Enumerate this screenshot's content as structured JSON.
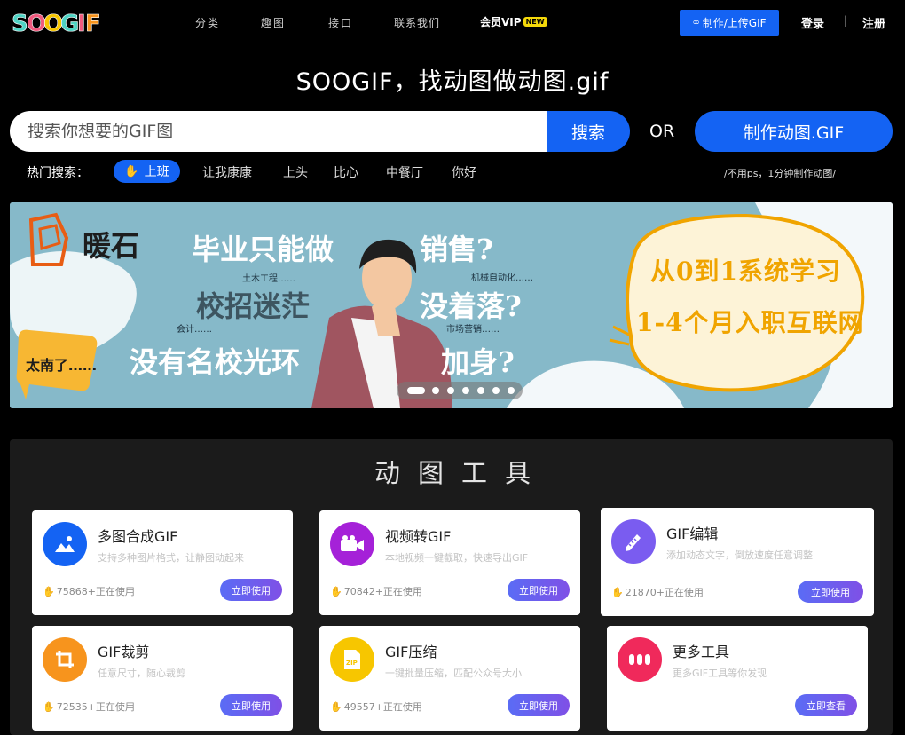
{
  "nav": {
    "logo_text": "SOOGIF",
    "links": [
      "分类",
      "趣图",
      "接口",
      "联系我们"
    ],
    "vip_label": "会员VIP",
    "vip_badge": "NEW",
    "upload_label": "制作/上传GIF",
    "login": "登录",
    "separator": "|",
    "register": "注册"
  },
  "hero": {
    "title": "SOOGIF，找动图做动图.gif",
    "search_placeholder": "搜索你想要的GIF图",
    "search_button": "搜索",
    "or_text": "OR",
    "make_button": "制作动图.GIF",
    "hot_label": "热门搜索：",
    "hot_tags": [
      "上班",
      "让我康康",
      "上头",
      "比心",
      "中餐厅",
      "你好"
    ],
    "hot_note": "/不用ps，1分钟制作动图/"
  },
  "banner": {
    "brand": "暖石",
    "line1a": "毕业只能做",
    "line1b": "销售?",
    "line2a": "校招迷茫",
    "line2b": "没着落?",
    "line3a": "没有名校光环",
    "line3b": "加身?",
    "small1": "土木工程……",
    "small2": "机械自动化……",
    "small3": "会计……",
    "small4": "市场营销……",
    "bubble": "太南了……",
    "right1": "从0到1系统学习",
    "right2": "1-4个月入职互联网",
    "slides": 7,
    "active_slide": 0
  },
  "tools": {
    "title": "动图工具",
    "cards": [
      {
        "name": "多图合成GIF",
        "desc": "支持多种图片格式，让静图动起来",
        "count": "75868+正在使用",
        "button": "立即使用",
        "icon": "image-icon",
        "color": "#1463f3"
      },
      {
        "name": "视频转GIF",
        "desc": "本地视频一键截取，快速导出GIF",
        "count": "70842+正在使用",
        "button": "立即使用",
        "icon": "video-camera-icon",
        "color": "#a521d8"
      },
      {
        "name": "GIF编辑",
        "desc": "添加动态文字，倒放速度任意调整",
        "count": "21870+正在使用",
        "button": "立即使用",
        "icon": "edit-ruler-icon",
        "color": "#7a5cf0"
      },
      {
        "name": "GIF裁剪",
        "desc": "任意尺寸，随心裁剪",
        "count": "72535+正在使用",
        "button": "立即使用",
        "icon": "crop-icon",
        "color": "#f7941d"
      },
      {
        "name": "GIF压缩",
        "desc": "一键批量压缩，匹配公众号大小",
        "count": "49557+正在使用",
        "button": "立即使用",
        "icon": "zip-icon",
        "color": "#f7c600"
      },
      {
        "name": "更多工具",
        "desc": "更多GIF工具等你发现",
        "count": "",
        "button": "立即查看",
        "icon": "more-icon",
        "color": "#f0295b"
      }
    ]
  }
}
